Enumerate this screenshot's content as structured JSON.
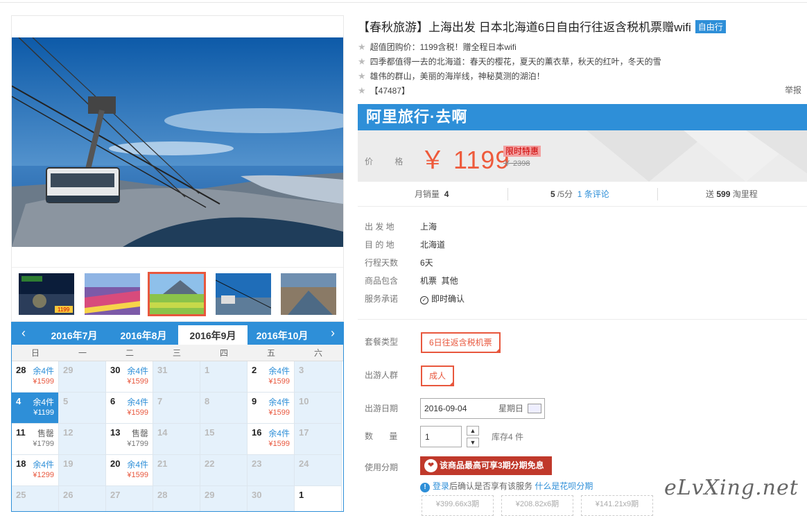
{
  "product": {
    "title": "【春秋旅游】上海出发 日本北海道6日自由行往返含税机票赠wifi",
    "tag": "自由行",
    "features": [
      "超值团购价：1199含税！赠全程日本wifi",
      "四季都值得一去的北海道：春天的樱花，夏天的薰衣草，秋天的红叶，冬天的雪",
      "雄伟的群山，美丽的海岸线，神秘莫测的湖泊！",
      "【47487】"
    ],
    "report": "举报"
  },
  "price": {
    "banner": "阿里旅行·去啊",
    "label": "价 格",
    "value": "￥ 1199",
    "promo": "限时特惠",
    "original": "￥ 2398"
  },
  "stats": {
    "sales_label": "月销量",
    "sales_value": "4",
    "rating_value": "5",
    "rating_suffix": "/5分",
    "reviews": "1 条评论",
    "miles_pre": "送",
    "miles_value": "599",
    "miles_post": "淘里程"
  },
  "info": [
    {
      "k": "出 发 地",
      "v": "上海"
    },
    {
      "k": "目 的 地",
      "v": "北海道"
    },
    {
      "k": "行程天数",
      "v": "6天"
    },
    {
      "k": "商品包含",
      "v": "机票  其他"
    },
    {
      "k": "服务承诺",
      "v": "即时确认"
    }
  ],
  "options": {
    "package_label": "套餐类型",
    "package_value": "6日往返含税机票",
    "traveler_label": "出游人群",
    "traveler_value": "成人",
    "date_label": "出游日期",
    "date_value": "2016-09-04",
    "weekday": "星期日",
    "qty_label": "数 量",
    "qty_value": "1",
    "stock": "库存4 件",
    "install_label": "使用分期",
    "install_btn": "该商品最高可享3期分期免息",
    "note_login": "登录",
    "note_mid": "后确认是否享有该服务",
    "note_link": "什么是花呗分期",
    "plans": [
      "¥399.66x3期",
      "¥208.82x6期",
      "¥141.21x9期"
    ]
  },
  "calendar": {
    "months": [
      "2016年7月",
      "2016年8月",
      "2016年9月",
      "2016年10月"
    ],
    "active_month": "2016年9月",
    "weekdays": [
      "日",
      "一",
      "二",
      "三",
      "四",
      "五",
      "六"
    ],
    "rows": [
      [
        {
          "d": "28",
          "s": "余4件",
          "p": "¥1599",
          "on": true
        },
        {
          "d": "29"
        },
        {
          "d": "30",
          "s": "余4件",
          "p": "¥1599",
          "on": true
        },
        {
          "d": "31"
        },
        {
          "d": "1"
        },
        {
          "d": "2",
          "s": "余4件",
          "p": "¥1599",
          "on": true
        },
        {
          "d": "3"
        }
      ],
      [
        {
          "d": "4",
          "s": "余4件",
          "p": "¥1199",
          "on": true,
          "sel": true
        },
        {
          "d": "5"
        },
        {
          "d": "6",
          "s": "余4件",
          "p": "¥1599",
          "on": true
        },
        {
          "d": "7"
        },
        {
          "d": "8"
        },
        {
          "d": "9",
          "s": "余4件",
          "p": "¥1599",
          "on": true
        },
        {
          "d": "10"
        }
      ],
      [
        {
          "d": "11",
          "s": "售罄",
          "p": "¥1799",
          "on": true,
          "sold": true
        },
        {
          "d": "12"
        },
        {
          "d": "13",
          "s": "售罄",
          "p": "¥1799",
          "on": true,
          "sold": true
        },
        {
          "d": "14"
        },
        {
          "d": "15"
        },
        {
          "d": "16",
          "s": "余4件",
          "p": "¥1599",
          "on": true
        },
        {
          "d": "17"
        }
      ],
      [
        {
          "d": "18",
          "s": "余4件",
          "p": "¥1299",
          "on": true
        },
        {
          "d": "19"
        },
        {
          "d": "20",
          "s": "余4件",
          "p": "¥1599",
          "on": true
        },
        {
          "d": "21"
        },
        {
          "d": "22"
        },
        {
          "d": "23"
        },
        {
          "d": "24"
        }
      ],
      [
        {
          "d": "25"
        },
        {
          "d": "26"
        },
        {
          "d": "27"
        },
        {
          "d": "28"
        },
        {
          "d": "29"
        },
        {
          "d": "30"
        },
        {
          "d": "1",
          "on": true
        }
      ]
    ]
  },
  "thumb_badges": [
    "1199"
  ],
  "watermark": "eLvXing.net",
  "colors": {
    "accent": "#2e8fd8",
    "price": "#ee5a3b",
    "select": "#e8573d"
  }
}
